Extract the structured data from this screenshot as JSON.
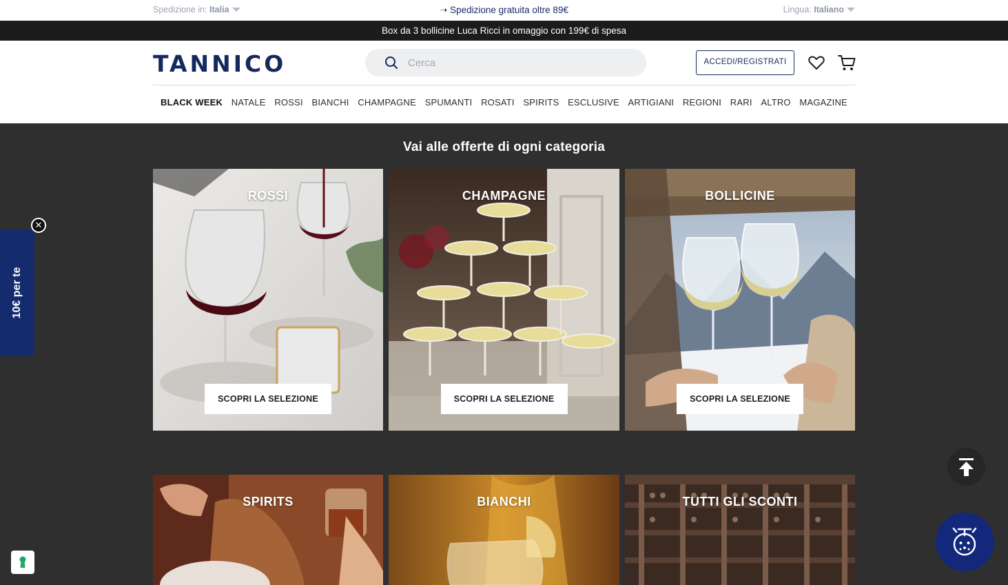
{
  "utility": {
    "shipping_label": "Spedizione in:",
    "shipping_value": "Italia",
    "free_shipping": "➝ Spedizione gratuita oltre 89€",
    "language_label": "Lingua:",
    "language_value": "Italiano"
  },
  "promo": {
    "text": "Box da 3 bollicine Luca Ricci in omaggio con 199€ di spesa"
  },
  "header": {
    "logo": "TANNICO",
    "search_placeholder": "Cerca",
    "login_label": "ACCEDI/REGISTRATI"
  },
  "nav": {
    "items": [
      "BLACK WEEK",
      "NATALE",
      "ROSSI",
      "BIANCHI",
      "CHAMPAGNE",
      "SPUMANTI",
      "ROSATI",
      "SPIRITS",
      "ESCLUSIVE",
      "ARTIGIANI",
      "REGIONI",
      "RARI",
      "ALTRO",
      "MAGAZINE"
    ]
  },
  "section": {
    "title": "Vai alle offerte di ogni categoria",
    "cta_label": "SCOPRI LA SELEZIONE",
    "tiles": [
      {
        "title": "ROSSI"
      },
      {
        "title": "CHAMPAGNE"
      },
      {
        "title": "BOLLICINE"
      },
      {
        "title": "SPIRITS"
      },
      {
        "title": "BIANCHI"
      },
      {
        "title": "TUTTI GLI SCONTI"
      }
    ]
  },
  "side_tab": {
    "label": "10€ per te"
  },
  "colors": {
    "brand_navy": "#15295f",
    "promo_bg": "#1c1c1c",
    "page_bg": "#2f2f2f"
  }
}
